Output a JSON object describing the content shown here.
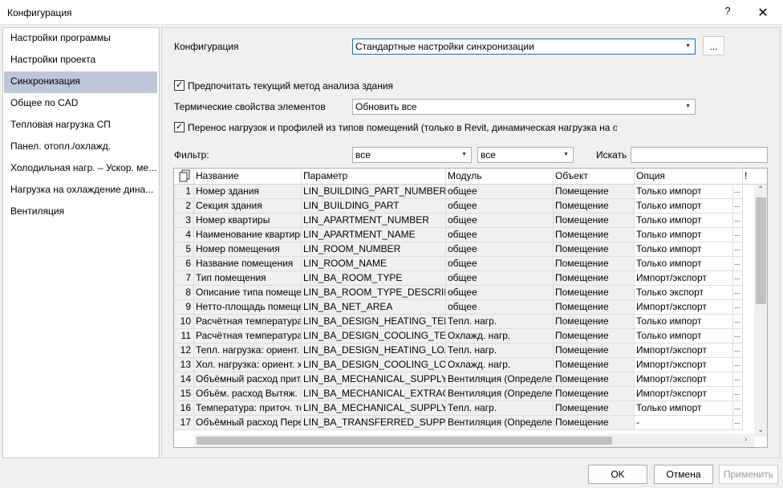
{
  "window": {
    "title": "Конфигурация",
    "help": "?",
    "close": "✕"
  },
  "nav": {
    "items": [
      "Настройки программы",
      "Настройки проекта",
      "Синхронизация",
      "Общее по CAD",
      "Тепловая нагрузка СП",
      "Панел. отопл./охлажд.",
      "Холодильная нагр. – Ускор. ме...",
      "Нагрузка на охлаждение дина...",
      "Вентиляция"
    ],
    "selected_index": 2
  },
  "config": {
    "label": "Конфигурация",
    "value": "Стандартные настройки синхронизации",
    "browse": "..."
  },
  "prefer_current": {
    "checked": true,
    "label": "Предпочитать текущий метод анализа здания"
  },
  "thermal": {
    "label": "Термические свойства элементов",
    "value": "Обновить все"
  },
  "transfer": {
    "checked": true,
    "label": "Перенос нагрузок и профилей из типов помещений (только в Revit, динамическая нагрузка на охлажден"
  },
  "filter": {
    "label": "Фильтр:",
    "value1": "все",
    "value2": "все",
    "search_label": "Искать",
    "search_value": ""
  },
  "grid": {
    "columns": [
      "Название",
      "Параметр",
      "Модуль",
      "Объект",
      "Опция",
      "!"
    ],
    "rows": [
      [
        "1",
        "Номер здания",
        "LIN_BUILDING_PART_NUMBER",
        "общее",
        "Помещение",
        "Только импорт"
      ],
      [
        "2",
        "Секция здания",
        "LIN_BUILDING_PART",
        "общее",
        "Помещение",
        "Только импорт"
      ],
      [
        "3",
        "Номер квартиры",
        "LIN_APARTMENT_NUMBER",
        "общее",
        "Помещение",
        "Только импорт"
      ],
      [
        "4",
        "Наименование квартиры",
        "LIN_APARTMENT_NAME",
        "общее",
        "Помещение",
        "Только импорт"
      ],
      [
        "5",
        "Номер помещения",
        "LIN_ROOM_NUMBER",
        "общее",
        "Помещение",
        "Только импорт"
      ],
      [
        "6",
        "Название помещения",
        "LIN_ROOM_NAME",
        "общее",
        "Помещение",
        "Только импорт"
      ],
      [
        "7",
        "Тип помещения",
        "LIN_BA_ROOM_TYPE",
        "общее",
        "Помещение",
        "Импорт/экспорт"
      ],
      [
        "8",
        "Описание типа помеще...",
        "LIN_BA_ROOM_TYPE_DESCRIPT...",
        "общее",
        "Помещение",
        "Только экспорт"
      ],
      [
        "9",
        "Нетто-площадь помеще...",
        "LIN_BA_NET_AREA",
        "общее",
        "Помещение",
        "Импорт/экспорт"
      ],
      [
        "10",
        "Расчётная температура ...",
        "LIN_BA_DESIGN_HEATING_TEM...",
        "Тепл. нагр.",
        "Помещение",
        "Только импорт"
      ],
      [
        "11",
        "Расчётная температура ...",
        "LIN_BA_DESIGN_COOLING_TEM...",
        "Охлажд. нагр.",
        "Помещение",
        "Только импорт"
      ],
      [
        "12",
        "Тепл. нагрузка: ориент. ...",
        "LIN_BA_DESIGN_HEATING_LOA...",
        "Тепл. нагр.",
        "Помещение",
        "Импорт/экспорт"
      ],
      [
        "13",
        "Хол. нагрузка: ориент. х...",
        "LIN_BA_DESIGN_COOLING_LOA...",
        "Охлажд. нагр.",
        "Помещение",
        "Импорт/экспорт"
      ],
      [
        "14",
        "Объёмный расход прит. ...",
        "LIN_BA_MECHANICAL_SUPPLY_...",
        "Вентиляция (Определен...",
        "Помещение",
        "Импорт/экспорт"
      ],
      [
        "15",
        "Объём. расход Вытяж. в...",
        "LIN_BA_MECHANICAL_EXTRACT...",
        "Вентиляция (Определен...",
        "Помещение",
        "Импорт/экспорт"
      ],
      [
        "16",
        "Температура: приточ. те...",
        "LIN_BA_MECHANICAL_SUPPLY_...",
        "Тепл. нагр.",
        "Помещение",
        "Только импорт"
      ],
      [
        "17",
        "Объёмный расход Пере...",
        "LIN_BA_TRANSFERRED_SUPPL...",
        "Вентиляция (Определен...",
        "Помещение",
        "-"
      ]
    ],
    "ellipsis": "...",
    "copy_icon": "copy-icon"
  },
  "buttons": {
    "ok": "OK",
    "cancel": "Отмена",
    "apply": "Применить"
  },
  "colors": {
    "selection": "#bcc8da",
    "accent": "#0078d7"
  }
}
